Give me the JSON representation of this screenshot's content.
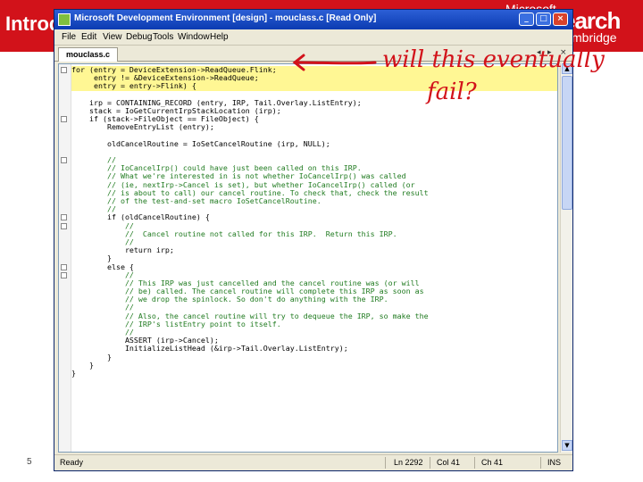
{
  "slide": {
    "title": "Introd",
    "number": "5",
    "logo": {
      "top": "Microsoft",
      "main": "earch",
      "sub": "mbridge"
    }
  },
  "window": {
    "title": "Microsoft Development Environment [design] - mouclass.c [Read Only]",
    "controls": {
      "minimize": "_",
      "maximize": "□",
      "close": "×"
    }
  },
  "menu": [
    "File",
    "Edit",
    "View",
    "Debug",
    "Tools",
    "Window",
    "Help"
  ],
  "tab": {
    "label": "mouclass.c",
    "prev": "◂",
    "next": "▸",
    "close": "×"
  },
  "code": {
    "lines": [
      "for (entry = DeviceExtension->ReadQueue.Flink;",
      "     entry != &DeviceExtension->ReadQueue;",
      "     entry = entry->Flink) {",
      "",
      "    irp = CONTAINING_RECORD (entry, IRP, Tail.Overlay.ListEntry);",
      "    stack = IoGetCurrentIrpStackLocation (irp);",
      "    if (stack->FileObject == FileObject) {",
      "        RemoveEntryList (entry);",
      "",
      "        oldCancelRoutine = IoSetCancelRoutine (irp, NULL);",
      "",
      "        //",
      "        // IoCancelIrp() could have just been called on this IRP.",
      "        // What we're interested in is not whether IoCancelIrp() was called",
      "        // (ie, nextIrp->Cancel is set), but whether IoCancelIrp() called (or",
      "        // is about to call) our cancel routine. To check that, check the result",
      "        // of the test-and-set macro IoSetCancelRoutine.",
      "        //",
      "        if (oldCancelRoutine) {",
      "            //",
      "            //  Cancel routine not called for this IRP.  Return this IRP.",
      "            //",
      "            return irp;",
      "        }",
      "        else {",
      "            //",
      "            // This IRP was just cancelled and the cancel routine was (or will",
      "            // be) called. The cancel routine will complete this IRP as soon as",
      "            // we drop the spinlock. So don't do anything with the IRP.",
      "            //",
      "            // Also, the cancel routine will try to dequeue the IRP, so make the",
      "            // IRP's listEntry point to itself.",
      "            //",
      "            ASSERT (irp->Cancel);",
      "            InitializeListHead (&irp->Tail.Overlay.ListEntry);",
      "        }",
      "    }",
      "}"
    ]
  },
  "status": {
    "ready": "Ready",
    "line": "Ln 2292",
    "col": "Col 41",
    "ch": "Ch 41",
    "mode": "INS"
  },
  "annotation": {
    "line1": "will this eventually",
    "line2": "fail?",
    "color": "#d2121a"
  },
  "colors": {
    "banner": "#d2121a",
    "titlebar": "#0b3bb1",
    "highlight": "#fff03c"
  }
}
